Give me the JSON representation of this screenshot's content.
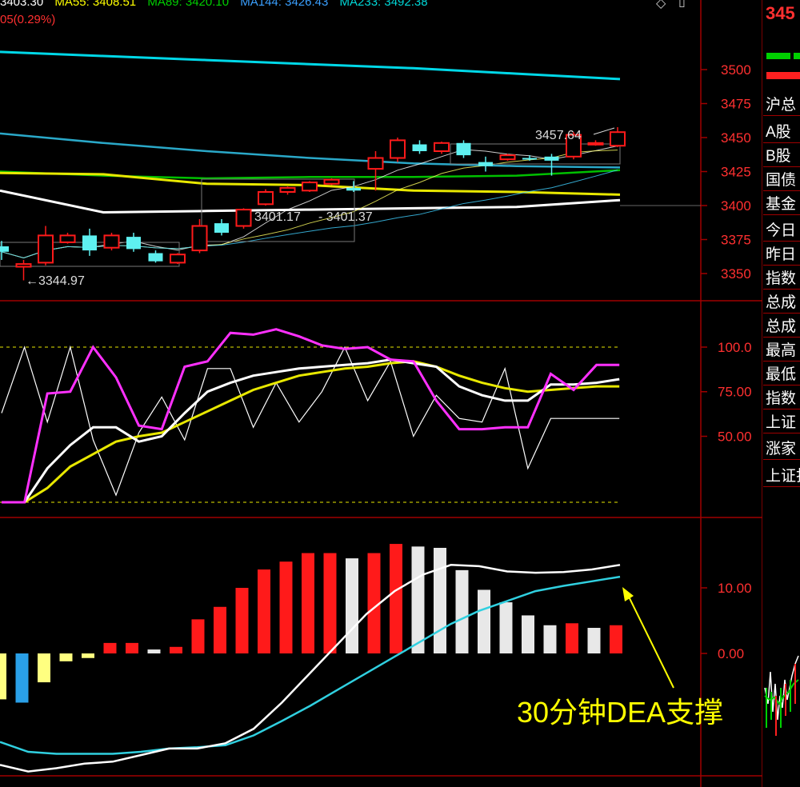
{
  "header": {
    "ma_line": [
      {
        "label": "3403.30",
        "color": "#ffffff"
      },
      {
        "label": "MA55: 3408.51",
        "color": "#ffff00"
      },
      {
        "label": "MA89: 3420.10",
        "color": "#00d000"
      },
      {
        "label": "MA144: 3426.43",
        "color": "#3aa0ff"
      },
      {
        "label": "MA233: 3492.38",
        "color": "#00d8d8"
      }
    ],
    "change_text": "05(0.29%)",
    "change_color": "#ff3030"
  },
  "annotation": {
    "text": "30分钟DEA支撑",
    "color": "#ffff00"
  },
  "sidebar": {
    "price_text": "345",
    "labels": [
      "沪总",
      "A股",
      "B股",
      "国债",
      "基金",
      "今日",
      "昨日",
      "指数",
      "总成",
      "总成",
      "最高",
      "最低",
      "指数",
      "上证",
      "涨家",
      "上证打"
    ]
  },
  "colors": {
    "up": "#ff1a1a",
    "down": "#5ef0f0",
    "axis_text": "#ff3030",
    "grid_red": "#a00000",
    "ma233": "#00d8e8",
    "ma144": "#2aa8c8",
    "ma89": "#00c000",
    "ma55": "#e8e800",
    "ma_white": "#ffffff",
    "kdj_k": "#ffffff",
    "kdj_d": "#e8e800",
    "kdj_j": "#ff30ff",
    "macd_dif": "#ffffff",
    "macd_dea": "#30d0e0",
    "bar_white": "#e8e8e8",
    "bar_yellow": "#ffff80",
    "bar_blue": "#2aa0e8"
  },
  "chart_data": [
    {
      "type": "candlestick",
      "name": "price",
      "y_axis_ticks": [
        "3500",
        "3475",
        "3450",
        "3425",
        "3400",
        "3375",
        "3350"
      ],
      "ylim": [
        3333,
        3522
      ],
      "candles": [
        {
          "o": 3370,
          "c": 3366,
          "h": 3374,
          "l": 3360
        },
        {
          "o": 3355,
          "c": 3357,
          "h": 3360,
          "l": 3345
        },
        {
          "o": 3358,
          "c": 3378,
          "h": 3385,
          "l": 3356
        },
        {
          "o": 3373,
          "c": 3378,
          "h": 3380,
          "l": 3372
        },
        {
          "o": 3378,
          "c": 3367,
          "h": 3383,
          "l": 3363
        },
        {
          "o": 3369,
          "c": 3378,
          "h": 3380,
          "l": 3367
        },
        {
          "o": 3377,
          "c": 3368,
          "h": 3380,
          "l": 3366
        },
        {
          "o": 3365,
          "c": 3359,
          "h": 3367,
          "l": 3358
        },
        {
          "o": 3358,
          "c": 3364,
          "h": 3365,
          "l": 3357
        },
        {
          "o": 3367,
          "c": 3385,
          "h": 3390,
          "l": 3365
        },
        {
          "o": 3387,
          "c": 3380,
          "h": 3390,
          "l": 3378
        },
        {
          "o": 3385,
          "c": 3397,
          "h": 3398,
          "l": 3383
        },
        {
          "o": 3401,
          "c": 3410,
          "h": 3412,
          "l": 3400
        },
        {
          "o": 3410,
          "c": 3413,
          "h": 3414,
          "l": 3408
        },
        {
          "o": 3411,
          "c": 3417,
          "h": 3418,
          "l": 3410
        },
        {
          "o": 3416,
          "c": 3419,
          "h": 3420,
          "l": 3415
        },
        {
          "o": 3413,
          "c": 3411,
          "h": 3418,
          "l": 3410
        },
        {
          "o": 3427,
          "c": 3435,
          "h": 3440,
          "l": 3411
        },
        {
          "o": 3435,
          "c": 3448,
          "h": 3450,
          "l": 3432
        },
        {
          "o": 3445,
          "c": 3440,
          "h": 3448,
          "l": 3438
        },
        {
          "o": 3440,
          "c": 3446,
          "h": 3447,
          "l": 3438
        },
        {
          "o": 3446,
          "c": 3437,
          "h": 3448,
          "l": 3435
        },
        {
          "o": 3432,
          "c": 3429,
          "h": 3436,
          "l": 3425
        },
        {
          "o": 3434,
          "c": 3437,
          "h": 3438,
          "l": 3433
        },
        {
          "o": 3435,
          "c": 3434,
          "h": 3437,
          "l": 3433
        },
        {
          "o": 3436,
          "c": 3433,
          "h": 3438,
          "l": 3422
        },
        {
          "o": 3436,
          "c": 3452,
          "h": 3454,
          "l": 3434
        },
        {
          "o": 3445,
          "c": 3446,
          "h": 3448,
          "l": 3444
        },
        {
          "o": 3444,
          "c": 3454,
          "h": 3457.64,
          "l": 3443
        }
      ],
      "ma233": [
        3513,
        3510,
        3507,
        3504,
        3501,
        3497,
        3493
      ],
      "ma144": [
        3453,
        3446,
        3440,
        3435,
        3431,
        3429,
        3428
      ],
      "ma89": [
        3425,
        3422,
        3420,
        3421,
        3421,
        3422,
        3426
      ],
      "ma55": [
        3424,
        3423,
        3416,
        3415,
        3411,
        3410,
        3408
      ],
      "ma_white": [
        3411,
        3395,
        3396,
        3397,
        3398,
        3399,
        3404
      ],
      "labels": {
        "high": "3457.64",
        "low": "3344.97",
        "box_left": "3401.17",
        "box_right": "3401.37"
      }
    },
    {
      "type": "line",
      "name": "kdj",
      "y_axis_ticks": [
        "100.0",
        "75.00",
        "50.00"
      ],
      "ylim": [
        13,
        115
      ],
      "k": [
        13,
        13,
        32,
        45,
        55,
        55,
        47,
        50,
        63,
        75,
        80,
        84,
        86,
        88,
        89,
        90,
        91,
        93,
        91,
        89,
        78,
        73,
        70,
        70,
        79,
        79,
        80,
        82
      ],
      "d": [
        13,
        13,
        21,
        33,
        40,
        47,
        50,
        52,
        58,
        64,
        70,
        76,
        80,
        84,
        86,
        88,
        89,
        91,
        92,
        89,
        84,
        80,
        77,
        75,
        76,
        77,
        78,
        78
      ],
      "j": [
        13,
        13,
        74,
        75,
        100,
        83,
        56,
        54,
        89,
        92,
        108,
        107,
        110,
        106,
        101,
        99,
        100,
        93,
        92,
        70,
        54,
        54,
        55,
        55,
        85,
        76,
        90,
        90
      ],
      "rsv": [
        63,
        100,
        58,
        100,
        48,
        17,
        52,
        72,
        48,
        88,
        88,
        55,
        80,
        58,
        75,
        100,
        70,
        92,
        50,
        73,
        60,
        58,
        88,
        32,
        60,
        60,
        60,
        60
      ]
    },
    {
      "type": "bar",
      "name": "macd",
      "y_axis_ticks": [
        "10.00",
        "0.00"
      ],
      "ylim": [
        -19,
        17
      ],
      "bars": [
        -7,
        -7.5,
        -4.4,
        -1.2,
        -0.7,
        1.6,
        1.6,
        0.6,
        1.0,
        5.2,
        7.1,
        10.0,
        12.8,
        14.0,
        15.3,
        15.3,
        14.5,
        15.3,
        16.7,
        16.3,
        16.1,
        12.7,
        9.7,
        7.8,
        5.8,
        4.3,
        4.6,
        3.9,
        4.3
      ],
      "bar_colors": [
        "yellow",
        "blue",
        "yellow",
        "yellow",
        "yellow",
        "red",
        "red",
        "white",
        "red",
        "red",
        "red",
        "red",
        "red",
        "red",
        "red",
        "red",
        "white",
        "red",
        "red",
        "white",
        "white",
        "white",
        "white",
        "white",
        "white",
        "white",
        "red",
        "white",
        "red"
      ],
      "dif": [
        -17,
        -18,
        -17.5,
        -16.8,
        -16.5,
        -15.5,
        -14.5,
        -14.5,
        -13.7,
        -11.5,
        -7.5,
        -3.0,
        1.5,
        6.0,
        9.5,
        12,
        13.5,
        13.3,
        12.5,
        12.3,
        12.4,
        12.8,
        13.5
      ],
      "dea": [
        -13.5,
        -15,
        -15.3,
        -15.3,
        -15.3,
        -15.0,
        -14.5,
        -14.3,
        -14.0,
        -12.5,
        -10.3,
        -8.0,
        -5.5,
        -3.0,
        -0.5,
        2.0,
        4.5,
        6.5,
        8.0,
        9.5,
        10.3,
        11.0,
        11.7
      ]
    }
  ]
}
